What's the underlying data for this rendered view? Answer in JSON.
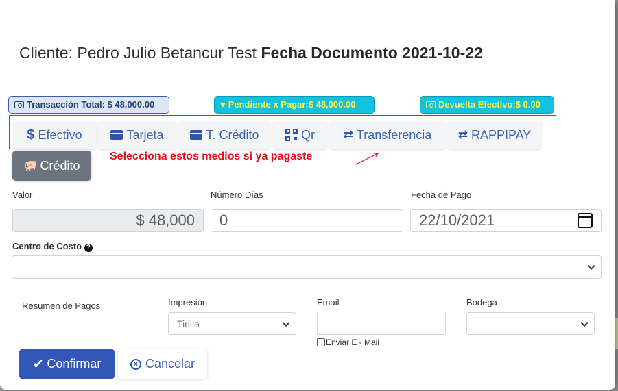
{
  "header": {
    "client_label": "Cliente: Pedro Julio Betancur Test",
    "date_label": "Fecha Documento 2021-10-22"
  },
  "badges": {
    "total": "Transacción Total: $ 48,000.00",
    "pending": "Pendiente x Pagar:$ 48,000.00",
    "change": "Devuelta Efectivo:$ 0.00"
  },
  "payment_methods": [
    {
      "label": "Efectivo",
      "icon": "dollar-icon"
    },
    {
      "label": "Tarjeta",
      "icon": "credit-card-icon"
    },
    {
      "label": "T. Crédito",
      "icon": "credit-card-icon"
    },
    {
      "label": "Qr",
      "icon": "qrcode-icon"
    },
    {
      "label": "Transferencia",
      "icon": "exchange-icon"
    },
    {
      "label": "RAPPIPAY",
      "icon": "exchange-icon"
    }
  ],
  "credit_button": {
    "label": "Crédito",
    "icon": "piggy-bank-icon"
  },
  "hint": "Selecciona estos medios si ya pagaste",
  "form": {
    "valor_label": "Valor",
    "valor_value": "$ 48,000",
    "dias_label": "Número Días",
    "dias_value": "0",
    "fecha_label": "Fecha de Pago",
    "fecha_value": "22/10/2021",
    "centro_label": "Centro de Costo",
    "centro_value": "",
    "resumen_label": "Resumen de Pagos",
    "impresion_label": "Impresión",
    "impresion_value": "Tirilla",
    "email_label": "Email",
    "email_value": "",
    "enviar_label": "Enviar E - Mail",
    "bodega_label": "Bodega",
    "bodega_value": ""
  },
  "actions": {
    "confirm": "Confirmar",
    "cancel": "Cancelar"
  },
  "colors": {
    "primary": "#3257b8",
    "info_badge": "#12c2e0",
    "badge_text": "#fff04a",
    "hint_red": "#e0151b",
    "secondary": "#6c757d"
  }
}
